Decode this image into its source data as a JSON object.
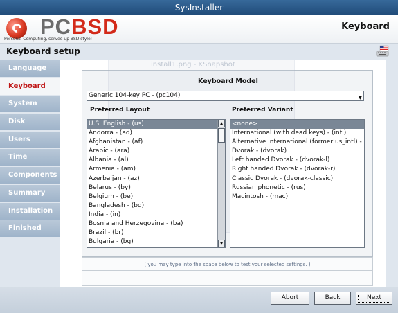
{
  "window": {
    "title": "SysInstaller"
  },
  "header": {
    "logo_pc": "PC",
    "logo_bsd": "BSD",
    "tagline": "Personal Computing, served up BSD style!",
    "section_title": "Keyboard"
  },
  "setup": {
    "title": "Keyboard setup",
    "icon": "keyboard-flag-icon"
  },
  "sidebar": {
    "items": [
      {
        "label": "Language"
      },
      {
        "label": "Keyboard",
        "active": true
      },
      {
        "label": "System"
      },
      {
        "label": "Disk"
      },
      {
        "label": "Users"
      },
      {
        "label": "Time"
      },
      {
        "label": "Components"
      },
      {
        "label": "Summary"
      },
      {
        "label": "Installation"
      },
      {
        "label": "Finished"
      }
    ]
  },
  "keyboard": {
    "model_label": "Keyboard Model",
    "model_value": "Generic 104-key PC - (pc104)",
    "layout_label": "Preferred Layout",
    "variant_label": "Preferred Variant",
    "layouts": [
      "U.S. English - (us)",
      "Andorra - (ad)",
      "Afghanistan - (af)",
      "Arabic - (ara)",
      "Albania - (al)",
      "Armenia - (am)",
      "Azerbaijan - (az)",
      "Belarus - (by)",
      "Belgium - (be)",
      "Bangladesh - (bd)",
      "India - (in)",
      "Bosnia and Herzegovina - (ba)",
      "Brazil - (br)",
      "Bulgaria - (bg)"
    ],
    "variants": [
      "<none>",
      "International (with dead keys) - (intl)",
      "Alternative international (former us_intl) - ...",
      "Dvorak - (dvorak)",
      "Left handed Dvorak - (dvorak-l)",
      "Right handed Dvorak - (dvorak-r)",
      "Classic Dvorak - (dvorak-classic)",
      "Russian phonetic - (rus)",
      "Macintosh - (mac)"
    ],
    "test_hint": "( you may type into the space below to test your selected settings. )"
  },
  "background_snapshot": {
    "title": "install1.png - KSnapshot"
  },
  "footer": {
    "abort_label": "Abort",
    "back_label": "Back",
    "next_label": "Next"
  }
}
